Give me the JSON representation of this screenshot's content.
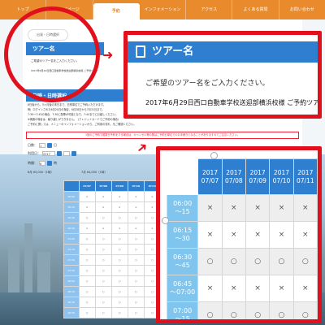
{
  "nav": [
    "トップ",
    "マイページ",
    "予約",
    "インフォメーション",
    "アクセス",
    "よくある質問",
    "お問い合わせ"
  ],
  "nav_active_index": 2,
  "breadcrumb": "出発・日時選択",
  "tour": {
    "heading": "ツアー名",
    "prompt": "ご希望のツアー名をご入力ください。",
    "selected": "2017年6月29日西口自動車学校送迎部横浜校様 ご予約ツアー"
  },
  "section2_heading": "日時・日時選択",
  "info_text": [
    "8日後から、5ヶ月後の末日まで、日別単位でご予約いただけます。",
    "例）ログインされた6月20日の場合、6月28日から7月31日まで。",
    "7:30〜7:45の場合、7:30に配車が可能となり、7:44までにお越しください。",
    "※満席の場合は、繰り越しができません。（クレジットカードでご予約の場合）",
    "ご予約に関しては、メニューのインフォメーションから、ご利用の流れ、をご確認ください。"
  ],
  "red_note": "1回のご予約で複数日予約をする場合は、キャンセル等の際はご予約日単位でのお手続きとなることがありますのでご注意ください。",
  "form": {
    "date_label": "日数：",
    "date_value": "1",
    "date_unit": "日",
    "month_label": "利用日：",
    "month_value": "2017",
    "time_label": "時間：",
    "time_value": "6",
    "time_unit": "時"
  },
  "search_label": "検索",
  "date_left": "6月 ¥5,000（1時）",
  "date_right": "7月 ¥4,000（1時）",
  "table": {
    "dates": [
      [
        "2017",
        "07/07"
      ],
      [
        "2017",
        "07/08"
      ],
      [
        "2017",
        "07/09"
      ],
      [
        "2017",
        "07/10"
      ],
      [
        "2017",
        "07/11"
      ]
    ],
    "rows": [
      {
        "time": [
          "06:00",
          "〜15"
        ],
        "cells": [
          "×",
          "×",
          "×",
          "×",
          "×"
        ]
      },
      {
        "time": [
          "06:15",
          "〜30"
        ],
        "cells": [
          "×",
          "×",
          "×",
          "×",
          "×"
        ]
      },
      {
        "time": [
          "06:30",
          "〜45"
        ],
        "cells": [
          "○",
          "○",
          "○",
          "○",
          "○"
        ]
      },
      {
        "time": [
          "06:45",
          "〜07:00"
        ],
        "cells": [
          "×",
          "×",
          "×",
          "×",
          "×"
        ]
      },
      {
        "time": [
          "07:00",
          "〜15"
        ],
        "cells": [
          "○",
          "○",
          "○",
          "○",
          "○"
        ]
      }
    ]
  },
  "small_table": {
    "dates": [
      "07/07",
      "07/08",
      "07/09",
      "07/10",
      "07/11"
    ],
    "times": [
      "06:00",
      "06:15",
      "06:30",
      "06:45",
      "07:00",
      "07:15",
      "07:30",
      "07:45",
      "08:00",
      "08:15",
      "08:30",
      "08:45"
    ],
    "cells": [
      [
        "×",
        "×",
        "×",
        "×",
        "×"
      ],
      [
        "×",
        "×",
        "×",
        "×",
        "×"
      ],
      [
        "○",
        "○",
        "○",
        "○",
        "○"
      ],
      [
        "×",
        "×",
        "×",
        "×",
        "×"
      ],
      [
        "○",
        "○",
        "○",
        "○",
        "○"
      ],
      [
        "○",
        "○",
        "○",
        "○",
        "○"
      ],
      [
        "○",
        "○",
        "○",
        "○",
        "○"
      ],
      [
        "○",
        "○",
        "○",
        "○",
        "○"
      ],
      [
        "○",
        "○",
        "○",
        "○",
        "○"
      ],
      [
        "○",
        "○",
        "○",
        "○",
        "○"
      ],
      [
        "○",
        "○",
        "○",
        "○",
        "○"
      ],
      [
        "○",
        "○",
        "○",
        "○",
        "○"
      ]
    ]
  },
  "colors": {
    "nav": "#e98a2c",
    "accent_blue": "#2f7fd1",
    "time_cell": "#7fc5ee",
    "highlight_red": "#e0101c"
  },
  "icons": {
    "tour_icon": "document-icon"
  }
}
